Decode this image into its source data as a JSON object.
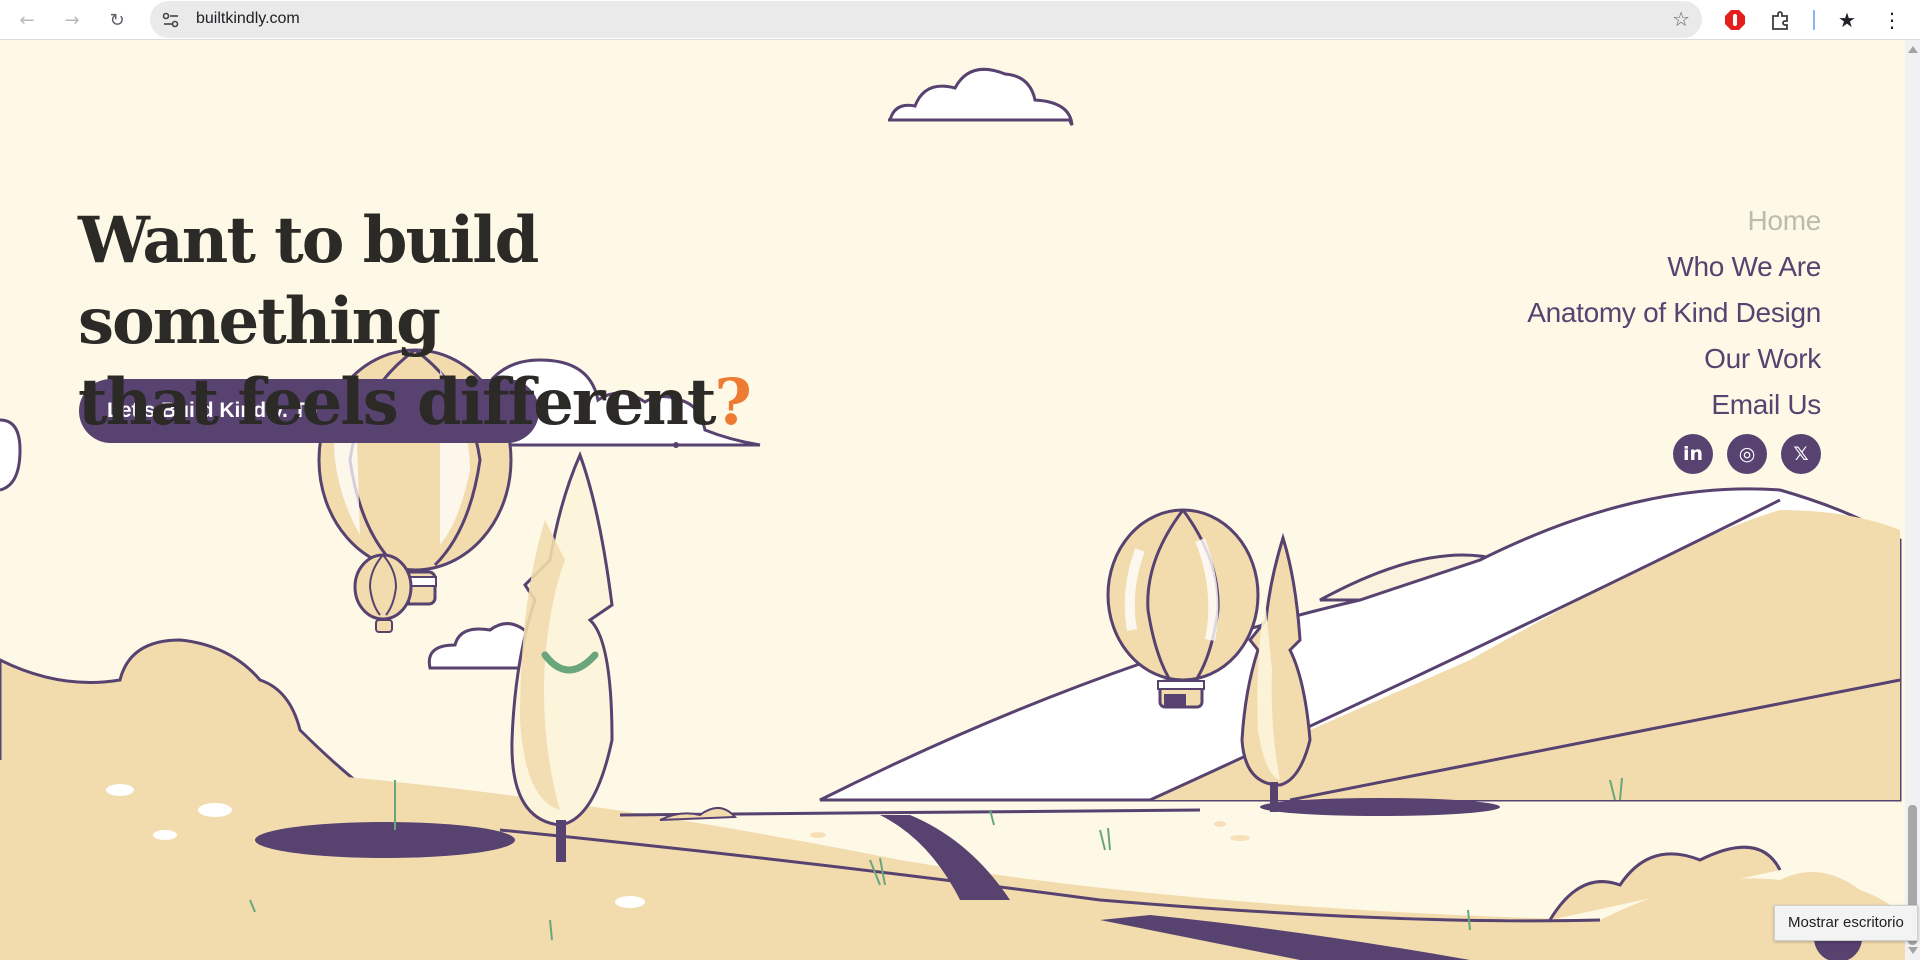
{
  "browser": {
    "url": "builtkindly.com",
    "icons": {
      "back": "back-arrow-icon",
      "forward": "forward-arrow-icon",
      "reload": "reload-icon",
      "site_info": "site-info-icon",
      "bookmark": "star-icon",
      "extensions": [
        "adblock-icon",
        "puzzle-extensions-icon",
        "bookmarks-star-icon",
        "kebab-menu-icon"
      ]
    }
  },
  "hero": {
    "title_line1": "Want to build something",
    "title_line2": "that feels different",
    "title_mark": "?",
    "cta_label": "Let’s Build Kindly. To"
  },
  "nav": {
    "items": [
      {
        "label": "Home",
        "active": true
      },
      {
        "label": "Who We Are",
        "active": false
      },
      {
        "label": "Anatomy of Kind Design",
        "active": false
      },
      {
        "label": "Our Work",
        "active": false
      },
      {
        "label": "Email Us",
        "active": false
      }
    ]
  },
  "social": [
    {
      "icon": "linkedin-icon",
      "glyph": "in"
    },
    {
      "icon": "instagram-icon",
      "glyph": "◎"
    },
    {
      "icon": "x-twitter-icon",
      "glyph": "𝕏"
    }
  ],
  "tooltip": {
    "text": "Mostrar escritorio"
  },
  "colors": {
    "background": "#fdf9e6",
    "brand_purple": "#574270",
    "accent_orange": "#ee7b32",
    "hill_sand": "#f2dcae",
    "text_dark": "#2b2a27",
    "inactive_nav": "#bdbab0"
  }
}
